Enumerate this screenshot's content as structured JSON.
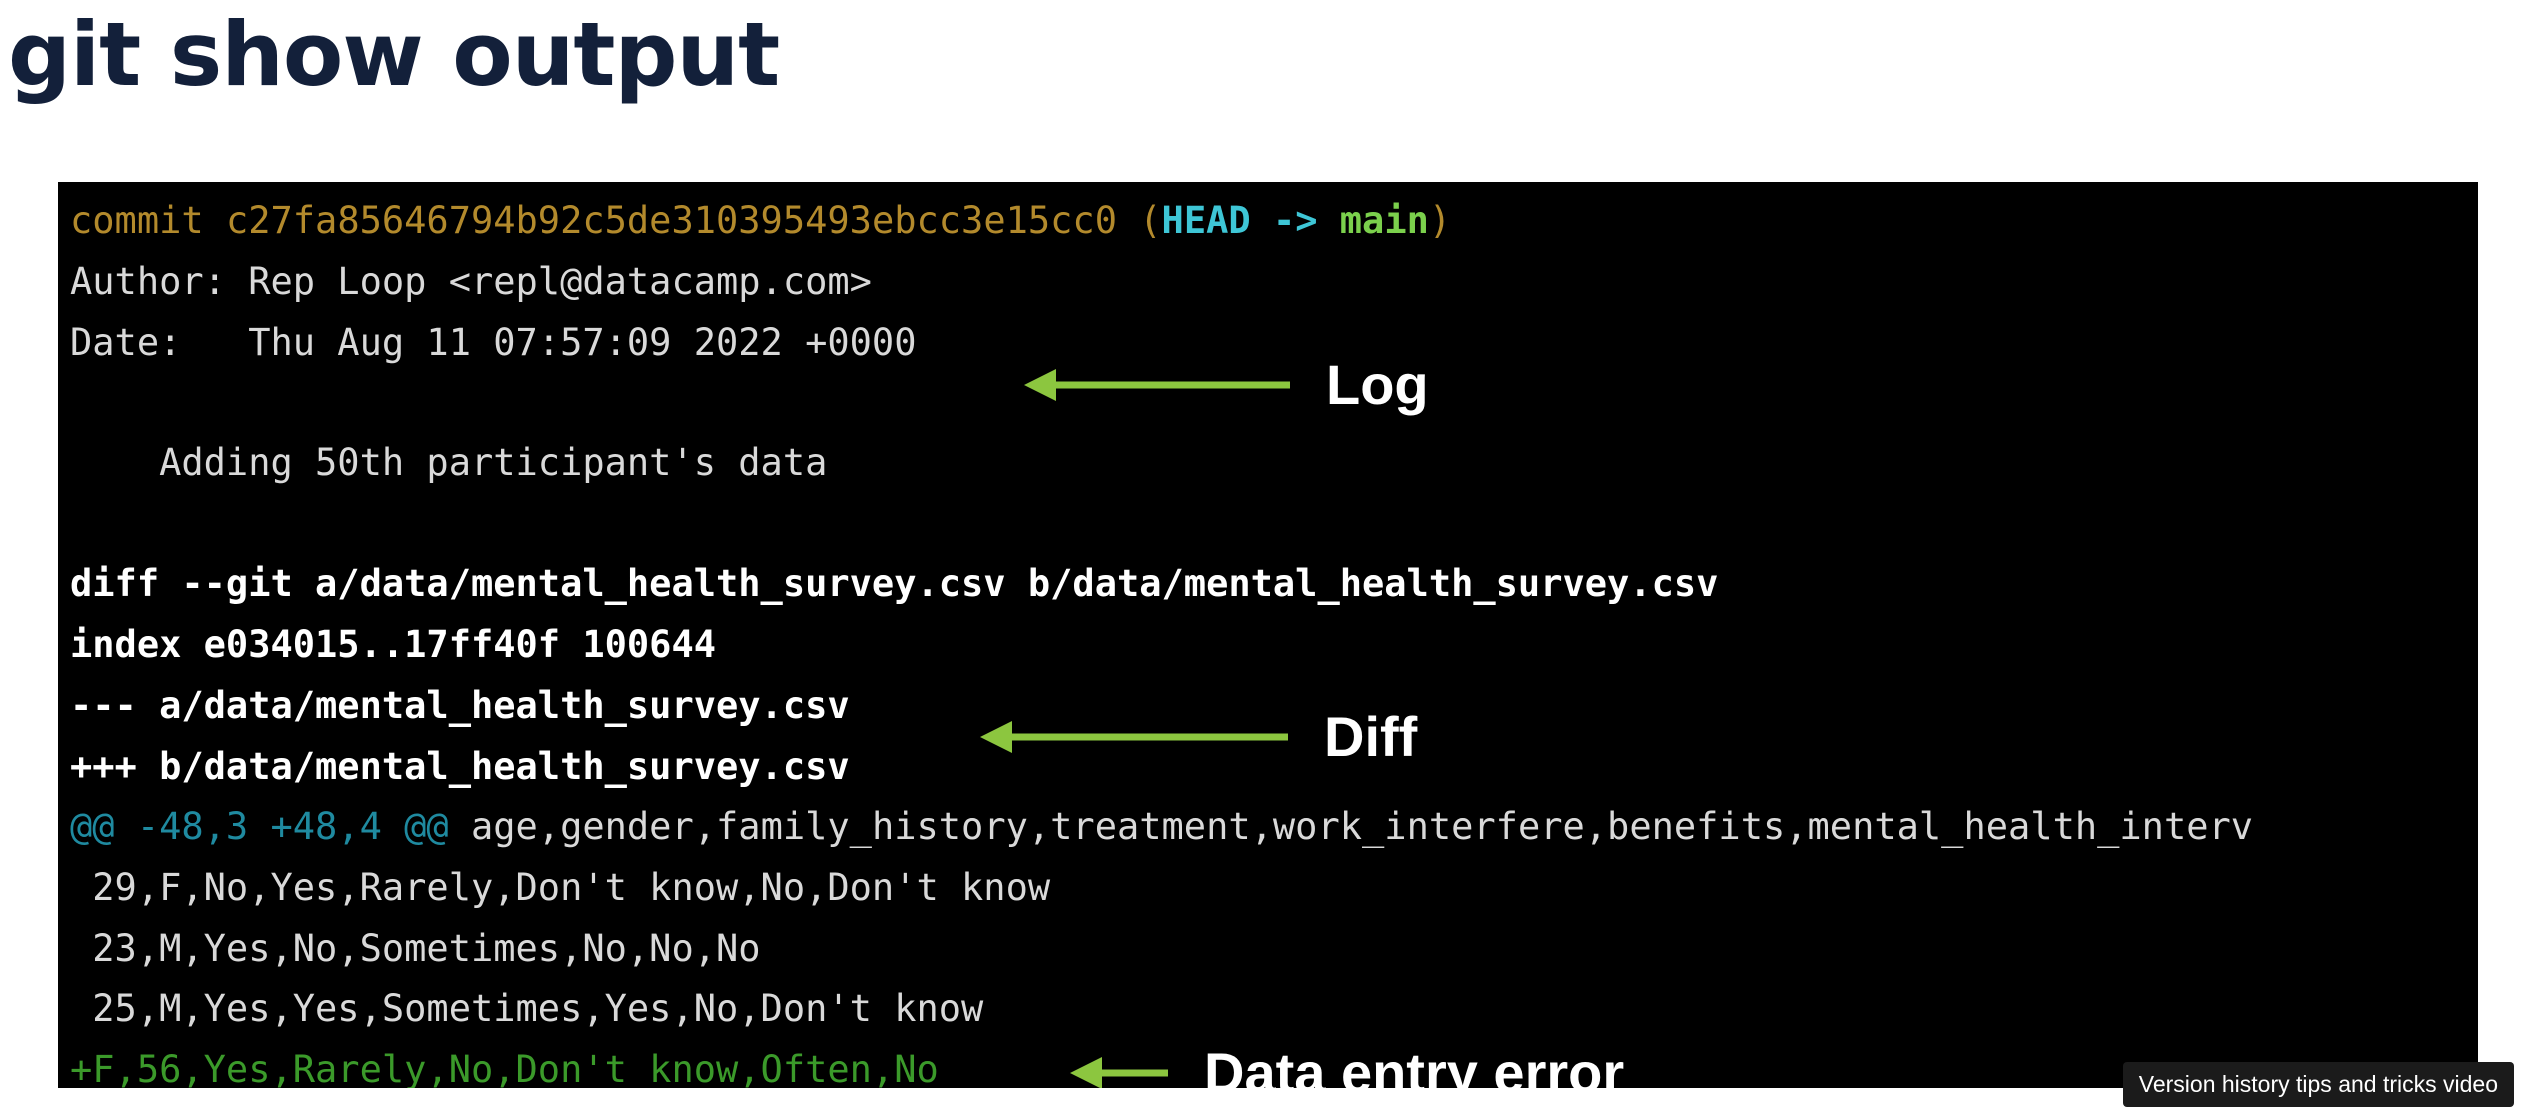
{
  "slide": {
    "title": "git show output"
  },
  "terminal": {
    "commit": {
      "keyword": "commit",
      "hash": "c27fa85646794b92c5de310395493ebcc3e15cc0",
      "paren_open": "(",
      "head": "HEAD",
      "arrow": "->",
      "branch": "main",
      "paren_close": ")"
    },
    "author_line": "Author: Rep Loop <repl@datacamp.com>",
    "date_line": "Date:   Thu Aug 11 07:57:09 2022 +0000",
    "message_line": "    Adding 50th participant's data",
    "diff_header": "diff --git a/data/mental_health_survey.csv b/data/mental_health_survey.csv",
    "index_line": "index e034015..17ff40f 100644",
    "minus_file": "--- a/data/mental_health_survey.csv",
    "plus_file": "+++ b/data/mental_health_survey.csv",
    "hunk": {
      "marker": "@@ -48,3 +48,4 @@",
      "context": " age,gender,family_history,treatment,work_interfere,benefits,mental_health_interv"
    },
    "context_lines": [
      " 29,F,No,Yes,Rarely,Don't know,No,Don't know",
      " 23,M,Yes,No,Sometimes,No,No,No",
      " 25,M,Yes,Yes,Sometimes,Yes,No,Don't know"
    ],
    "added_line": "+F,56,Yes,Rarely,No,Don't know,Often,No"
  },
  "annotations": {
    "log": "Log",
    "diff": "Diff",
    "error": "Data entry error"
  },
  "tooltip": "Version history tips and tricks video",
  "colors": {
    "arrow": "#8cc63f",
    "hash": "#b38a2c",
    "head": "#3ec6d6",
    "branch": "#7bd04c",
    "hunk": "#1f8aa0",
    "added": "#3b9a2a",
    "title": "#13203a"
  }
}
